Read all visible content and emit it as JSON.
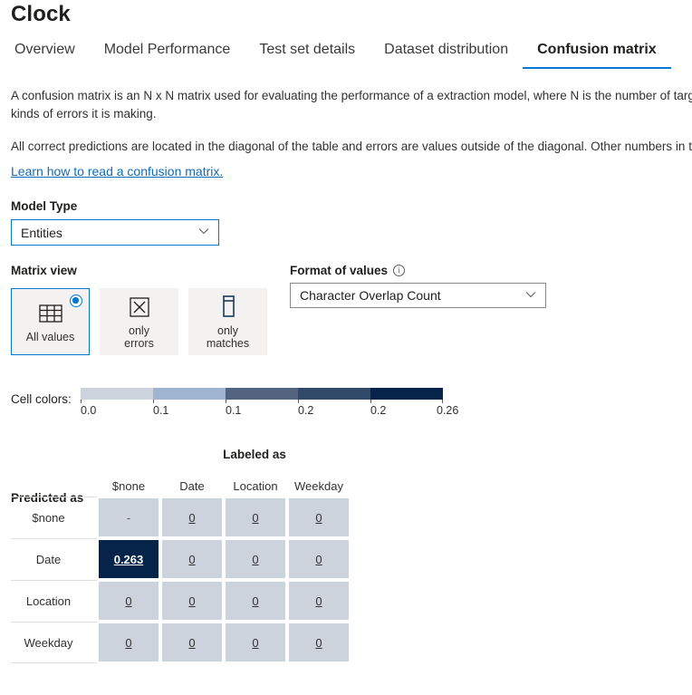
{
  "header": {
    "title": "Clock"
  },
  "tabs": [
    {
      "label": "Overview",
      "active": false
    },
    {
      "label": "Model Performance",
      "active": false
    },
    {
      "label": "Test set details",
      "active": false
    },
    {
      "label": "Dataset distribution",
      "active": false
    },
    {
      "label": "Confusion matrix",
      "active": true
    }
  ],
  "description": {
    "paragraph1": "A confusion matrix is an N x N matrix used for evaluating the performance of a extraction model, where N is the number of target kinds of errors it is making.",
    "paragraph2": "All correct predictions are located in the diagonal of the table and errors are values outside of the diagonal. Other numbers in the",
    "link": "Learn how to read a confusion matrix."
  },
  "model_type": {
    "label": "Model Type",
    "value": "Entities",
    "chevron": "⌄"
  },
  "matrix_view": {
    "label": "Matrix view",
    "options": [
      {
        "caption": "All values",
        "icon": "table-icon",
        "selected": true
      },
      {
        "caption": "only\nerrors",
        "caption_line1": "only",
        "caption_line2": "errors",
        "icon": "x-box-icon",
        "selected": false
      },
      {
        "caption": "only\nmatches",
        "caption_line1": "only",
        "caption_line2": "matches",
        "icon": "column-icon",
        "selected": false
      }
    ]
  },
  "format_of_values": {
    "label": "Format of values",
    "info_glyph": "i",
    "value": "Character Overlap Count",
    "chevron": "⌄"
  },
  "cell_colors": {
    "label": "Cell colors:",
    "swatches": [
      "#ccd3dd",
      "#9fb4d1",
      "#536480",
      "#324a6a",
      "#06244a"
    ],
    "ticks": [
      "0.0",
      "0.1",
      "0.1",
      "0.2",
      "0.2",
      "0.26"
    ]
  },
  "chart_data": {
    "type": "heatmap",
    "title": "Confusion matrix",
    "xlabel": "Labeled as",
    "ylabel": "Predicted as",
    "categories": [
      "$none",
      "Date",
      "Location",
      "Weekday"
    ],
    "rows": [
      "$none",
      "Date",
      "Location",
      "Weekday"
    ],
    "columns": [
      "$none",
      "Date",
      "Location",
      "Weekday"
    ],
    "values": [
      [
        "-",
        "0",
        "0",
        "0"
      ],
      [
        "0.263",
        "0",
        "0",
        "0"
      ],
      [
        "0",
        "0",
        "0",
        "0"
      ],
      [
        "0",
        "0",
        "0",
        "0"
      ]
    ],
    "highlighted_cells": [
      {
        "row": 1,
        "col": 0,
        "value": "0.263"
      }
    ],
    "colorscale": [
      "#ccd3dd",
      "#9fb4d1",
      "#536480",
      "#324a6a",
      "#06244a"
    ],
    "colorscale_ticks": [
      "0.0",
      "0.1",
      "0.1",
      "0.2",
      "0.2",
      "0.26"
    ],
    "value_format": "Character Overlap Count",
    "legend": "Cell colors:"
  }
}
